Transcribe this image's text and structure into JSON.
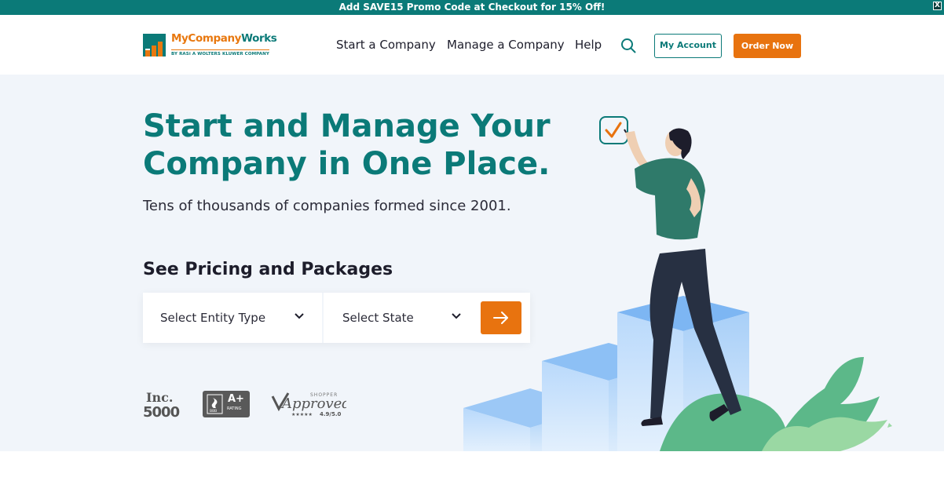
{
  "promo": {
    "text": "Add SAVE15 Promo Code at Checkout for 15% Off!",
    "close_label": "X"
  },
  "header": {
    "logo": {
      "name_part1": "MyCompany",
      "name_part2": "Works",
      "tagline": "BY RASi A WOLTERS KLUWER COMPANY"
    },
    "nav": {
      "start": "Start a Company",
      "manage": "Manage a Company",
      "help": "Help"
    },
    "search_icon": "search-icon",
    "account_label": "My Account",
    "order_label": "Order Now"
  },
  "hero": {
    "title": "Start and Manage Your Company in One Place.",
    "subtitle": "Tens of thousands of companies formed since 2001.",
    "pricing_title": "See Pricing and Packages",
    "entity_select": "Select Entity Type",
    "state_select": "Select State"
  },
  "badges": {
    "inc_top": "Inc.",
    "inc_num": "5000",
    "bbb_grade": "A+",
    "bbb_sub": "RATING",
    "bbb_logo": "BBB",
    "shopper_top": "SHOPPER",
    "shopper_word": "Approved",
    "shopper_rating": "4.9/5.0"
  },
  "colors": {
    "brand_teal": "#0b7a78",
    "brand_orange": "#e8730f",
    "hero_bg": "#f1f5fa"
  }
}
